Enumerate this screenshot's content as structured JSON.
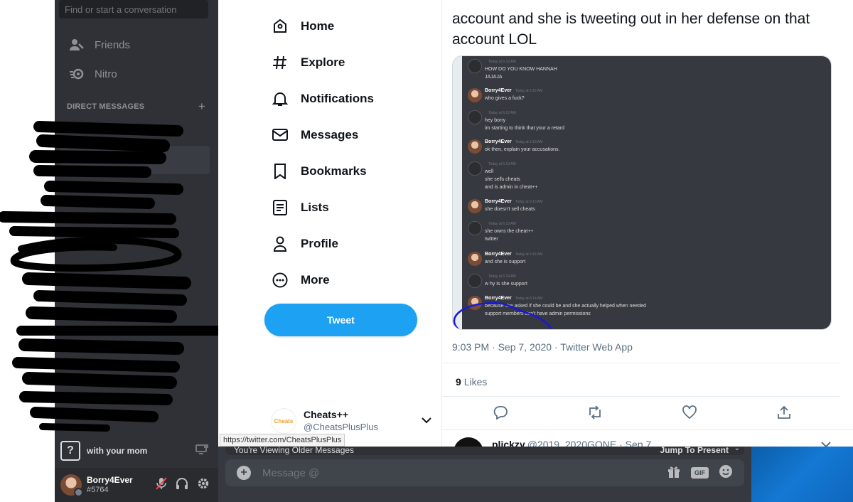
{
  "discord": {
    "search_placeholder": "Find or start a conversation",
    "nav_friends": "Friends",
    "nav_nitro": "Nitro",
    "dm_header": "DIRECT MESSAGES",
    "dm_add": "+",
    "status_text": "with your mom",
    "status_icon": "?",
    "user_name": "Borry4Ever",
    "user_tag": "#5764",
    "older_messages": "You're Viewing Older Messages",
    "jump_to_present": "Jump To Present",
    "message_placeholder": "Message @",
    "gif_label": "GIF",
    "plus": "+"
  },
  "twitter": {
    "nav": [
      {
        "label": "Home",
        "icon": "home-icon"
      },
      {
        "label": "Explore",
        "icon": "hashtag-icon"
      },
      {
        "label": "Notifications",
        "icon": "bell-icon"
      },
      {
        "label": "Messages",
        "icon": "envelope-icon"
      },
      {
        "label": "Bookmarks",
        "icon": "bookmark-icon"
      },
      {
        "label": "Lists",
        "icon": "list-icon"
      },
      {
        "label": "Profile",
        "icon": "person-icon"
      },
      {
        "label": "More",
        "icon": "more-icon"
      }
    ],
    "tweet_button": "Tweet",
    "account_name": "Cheats++",
    "account_handle": "@CheatsPlusPlus",
    "account_avatar_text": "Cheats",
    "url_tooltip": "https://twitter.com/CheatsPlusPlus",
    "tweet_text": "account and she is tweeting out in her defense on that account LOL",
    "tweet_meta": "9:03 PM · Sep 7, 2020 · Twitter Web App",
    "likes_count": "9",
    "likes_label": "Likes",
    "reply_name": "plickzy",
    "reply_handle": "@2019_2020GONE · Sep 7"
  },
  "embedded_chat": [
    {
      "author": "",
      "time": "Today at 6:12 AM",
      "lines": [
        "HOW DO YOU KNOW HANNAH",
        "JAJAJA"
      ]
    },
    {
      "author": "Borry4Ever",
      "time": "Today at 6:12 AM",
      "lines": [
        "who gives a fuck?"
      ]
    },
    {
      "author": "",
      "time": "Today at 6:12 AM",
      "lines": [
        "hey borry",
        "im starting to think that your a retard"
      ]
    },
    {
      "author": "Borry4Ever",
      "time": "Today at 6:13 AM",
      "lines": [
        "ok then, explain your accusations."
      ]
    },
    {
      "author": "",
      "time": "Today at 6:13 AM",
      "lines": [
        "well",
        "she sells cheats",
        "and is admin in cheat++"
      ]
    },
    {
      "author": "Borry4Ever",
      "time": "Today at 6:13 AM",
      "lines": [
        "she doesn't sell cheats"
      ]
    },
    {
      "author": "",
      "time": "Today at 6:13 AM",
      "lines": [
        "she owns the cheat++",
        "twitter"
      ]
    },
    {
      "author": "Borry4Ever",
      "time": "Today at 6:14 AM",
      "lines": [
        "and she is support"
      ]
    },
    {
      "author": "",
      "time": "Today at 6:14 AM",
      "lines": [
        "w hy is she support"
      ]
    },
    {
      "author": "Borry4Ever",
      "time": "Today at 6:14 AM",
      "lines": [
        "because she asked if she could be and she actually helped when needed",
        "support members don't have admin permissions"
      ]
    }
  ],
  "colors": {
    "discord_dark": "#2f3136",
    "discord_chat": "#36393f",
    "twitter_blue": "#1da1f2",
    "circle_blue": "#1a1ad4"
  }
}
